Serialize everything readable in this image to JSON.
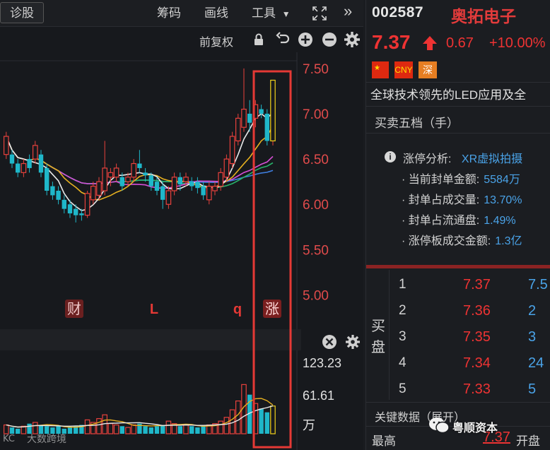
{
  "toolbar": {
    "diag": "诊股",
    "chips": "筹码",
    "draw": "画线",
    "tools": "工具",
    "collapse": "»",
    "adjust": "前复权"
  },
  "chart": {
    "price_ticks": [
      "7.50",
      "7.00",
      "6.50",
      "6.00",
      "5.50",
      "5.00"
    ],
    "vol_ticks": [
      "123.23",
      "61.61",
      "万"
    ],
    "markers": [
      "财",
      "L",
      "q",
      "涨"
    ],
    "colors": {
      "up": "#e8413c",
      "down": "#1fb7c9",
      "ma5": "#e9e9e9",
      "ma10": "#e6b020",
      "ma20": "#d64fd6",
      "ma30": "#27b36a",
      "ma60": "#3f7fe0",
      "highlight": "#e53935"
    }
  },
  "chart_data": {
    "type": "candlestick",
    "ylim": [
      4.7,
      7.6
    ],
    "candles": [
      [
        6.55,
        6.75,
        6.5,
        6.8
      ],
      [
        6.55,
        6.45,
        6.4,
        6.6
      ],
      [
        6.45,
        6.35,
        6.3,
        6.5
      ],
      [
        6.35,
        6.45,
        6.3,
        6.5
      ],
      [
        6.5,
        6.4,
        6.35,
        6.55
      ],
      [
        6.5,
        6.65,
        6.45,
        6.7
      ],
      [
        6.55,
        6.35,
        6.3,
        6.6
      ],
      [
        6.4,
        6.15,
        6.1,
        6.45
      ],
      [
        6.2,
        6.1,
        6.05,
        6.25
      ],
      [
        6.15,
        6.05,
        6.0,
        6.2
      ],
      [
        6.05,
        5.95,
        5.9,
        6.1
      ],
      [
        6.0,
        5.9,
        5.85,
        6.05
      ],
      [
        5.95,
        5.88,
        5.8,
        6.0
      ],
      [
        5.9,
        5.88,
        5.82,
        5.95
      ],
      [
        5.88,
        6.12,
        5.85,
        6.15
      ],
      [
        6.05,
        6.2,
        6.0,
        6.25
      ],
      [
        6.1,
        6.25,
        6.05,
        6.3
      ],
      [
        6.15,
        6.4,
        6.1,
        6.7
      ],
      [
        6.3,
        6.35,
        6.2,
        6.4
      ],
      [
        6.3,
        6.4,
        6.25,
        6.45
      ],
      [
        6.3,
        6.2,
        6.15,
        6.35
      ],
      [
        6.25,
        6.3,
        6.2,
        6.35
      ],
      [
        6.3,
        6.45,
        6.25,
        6.5
      ],
      [
        6.45,
        6.4,
        6.35,
        6.6
      ],
      [
        6.35,
        6.32,
        6.25,
        6.4
      ],
      [
        6.32,
        6.2,
        6.15,
        6.35
      ],
      [
        6.25,
        6.15,
        6.1,
        6.3
      ],
      [
        6.2,
        6.05,
        5.95,
        6.25
      ],
      [
        6.0,
        6.15,
        5.95,
        6.2
      ],
      [
        6.15,
        6.3,
        6.1,
        6.35
      ],
      [
        6.3,
        6.22,
        6.15,
        6.35
      ],
      [
        6.25,
        6.3,
        6.2,
        6.35
      ],
      [
        6.25,
        6.2,
        6.15,
        6.3
      ],
      [
        6.25,
        6.18,
        6.12,
        6.3
      ],
      [
        6.2,
        6.1,
        6.05,
        6.25
      ],
      [
        6.05,
        6.2,
        6.0,
        6.25
      ],
      [
        6.15,
        6.2,
        6.1,
        6.25
      ],
      [
        6.2,
        6.35,
        6.15,
        6.4
      ],
      [
        6.3,
        6.5,
        6.25,
        6.55
      ],
      [
        6.45,
        6.75,
        6.4,
        6.8
      ],
      [
        6.7,
        6.95,
        6.65,
        7.0
      ],
      [
        6.85,
        7.05,
        6.8,
        7.5
      ],
      [
        7.0,
        6.9,
        6.8,
        7.15
      ],
      [
        6.95,
        7.1,
        6.85,
        7.15
      ],
      [
        7.05,
        7.0,
        6.95,
        7.1
      ],
      [
        7.0,
        6.7,
        6.65,
        7.05
      ],
      [
        6.7,
        7.37,
        6.65,
        7.37
      ]
    ],
    "volume": [
      14,
      10,
      8,
      12,
      16,
      18,
      14,
      12,
      10,
      12,
      8,
      10,
      12,
      14,
      22,
      18,
      24,
      30,
      16,
      14,
      12,
      10,
      14,
      16,
      12,
      10,
      12,
      14,
      20,
      16,
      12,
      14,
      12,
      10,
      12,
      14,
      16,
      20,
      26,
      38,
      52,
      78,
      62,
      48,
      40,
      34,
      44
    ]
  },
  "quote": {
    "code": "002587",
    "name": "奥拓电子",
    "price": "7.37",
    "change": "0.67",
    "pct": "+10.00%",
    "tags": [
      "",
      "CNY",
      "深"
    ],
    "desc": "全球技术领先的LED应用及全"
  },
  "five": {
    "title": "买卖五档（手）",
    "limit_title": "涨停分析:",
    "limit_value": "XR虚拟拍摄",
    "lines": [
      {
        "label": "· 当前封单金额:",
        "value": "5584万"
      },
      {
        "label": "· 封单占成交量:",
        "value": "13.70%"
      },
      {
        "label": "· 封单占流通盘:",
        "value": "1.49%"
      },
      {
        "label": "· 涨停板成交金额:",
        "value": "1.3亿"
      }
    ],
    "buy_label": "买盘",
    "bids": [
      {
        "level": "1",
        "price": "7.37",
        "vol": "7.5"
      },
      {
        "level": "2",
        "price": "7.36",
        "vol": "2"
      },
      {
        "level": "3",
        "price": "7.35",
        "vol": "3"
      },
      {
        "level": "4",
        "price": "7.34",
        "vol": "24"
      },
      {
        "level": "5",
        "price": "7.33",
        "vol": "5"
      }
    ]
  },
  "key": {
    "title": "关键数据（展开）",
    "high_label": "最高",
    "high_value": "7.37",
    "open_label": "开盘"
  },
  "watermark": {
    "left": "大数跨境",
    "right": "粤顺资本"
  }
}
